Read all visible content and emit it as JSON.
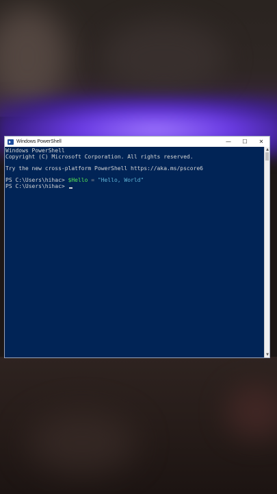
{
  "window": {
    "title": "Windows PowerShell",
    "controls": {
      "minimize": "—",
      "maximize": "☐",
      "close": "✕"
    }
  },
  "terminal": {
    "lines": [
      "Windows PowerShell",
      "Copyright (C) Microsoft Corporation. All rights reserved.",
      "",
      "Try the new cross-platform PowerShell https://aka.ms/pscore6",
      ""
    ],
    "command_line": {
      "prompt": "PS C:\\Users\\hihac> ",
      "variable": "$Hello",
      "operator": " = ",
      "string": "\"Hello, World\""
    },
    "current_prompt": "PS C:\\Users\\hihac> "
  },
  "colors": {
    "console_background": "#012456",
    "variable": "#55e655",
    "string": "#5fb3d6",
    "text": "#d6d6d6"
  }
}
